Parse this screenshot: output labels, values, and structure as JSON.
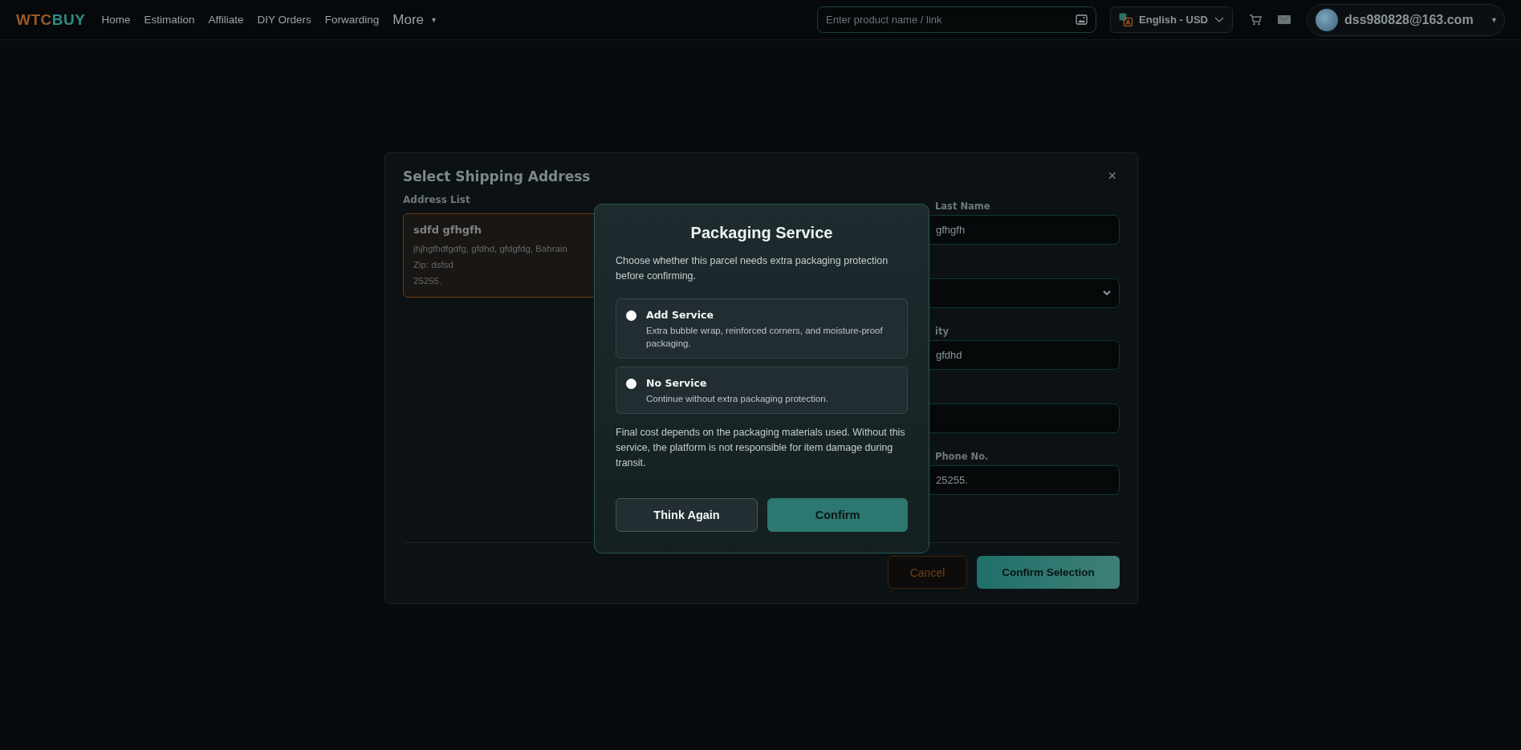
{
  "topbar": {
    "logo": {
      "first": "WTC",
      "second": "BUY"
    },
    "nav": [
      {
        "label": "Home"
      },
      {
        "label": "Estimation"
      },
      {
        "label": "Affiliate"
      },
      {
        "label": "DIY Orders"
      },
      {
        "label": "Forwarding"
      }
    ],
    "more": {
      "label": "More",
      "caret": "▼"
    },
    "search": {
      "placeholder": "Enter product name / link"
    },
    "language": {
      "label": "English - USD"
    },
    "user": {
      "email": "dss980828@163.com",
      "caret": "▼"
    }
  },
  "shipping_dialog": {
    "title": "Select Shipping Address",
    "close": "×",
    "address_list_label": "Address List",
    "addresses": [
      {
        "name": "sdfd gfhgfh",
        "lines": [
          "jhjhgfhdfgdfg, gfdhd, gfdgfdg, Bahrain",
          "Zip: dsfsd",
          "25255."
        ],
        "selected": true
      }
    ],
    "fields": [
      {
        "kind": "input",
        "label": "Last Name",
        "value": "gfhgfh"
      },
      {
        "kind": "select"
      },
      {
        "kind": "input",
        "label": "ity",
        "value": "gfdhd"
      },
      {
        "kind": "input"
      },
      {
        "kind": "input",
        "label": "Phone No.",
        "value": "25255."
      }
    ],
    "buttons": {
      "cancel": "Cancel",
      "confirm": "Confirm Selection"
    }
  },
  "packaging_dialog": {
    "title": "Packaging Service",
    "intro": "Choose whether this parcel needs extra packaging protection before confirming.",
    "options": [
      {
        "title": "Add Service",
        "description": "Extra bubble wrap, reinforced corners, and moisture-proof packaging.",
        "selected": false
      },
      {
        "title": "No Service",
        "description": "Continue without extra packaging protection.",
        "selected": false
      }
    ],
    "note": "Final cost depends on the packaging materials used. Without this service, the platform is not responsible for item damage during transit.",
    "buttons": {
      "back": "Think Again",
      "confirm": "Confirm"
    }
  }
}
